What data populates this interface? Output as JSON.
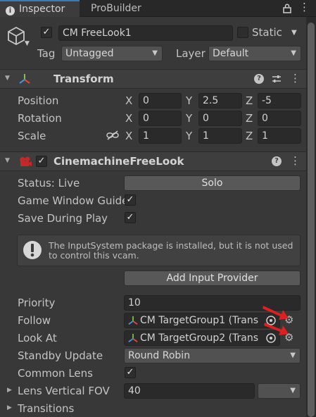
{
  "tabs": {
    "inspector": "Inspector",
    "probuilder": "ProBuilder"
  },
  "object": {
    "name": "CM FreeLook1",
    "static_label": "Static",
    "tag_label": "Tag",
    "tag_value": "Untagged",
    "layer_label": "Layer",
    "layer_value": "Default",
    "active": true,
    "static": false
  },
  "transform": {
    "title": "Transform",
    "position_label": "Position",
    "rotation_label": "Rotation",
    "scale_label": "Scale",
    "position": {
      "x": "0",
      "y": "2.5",
      "z": "-5"
    },
    "rotation": {
      "x": "0",
      "y": "0",
      "z": "0"
    },
    "scale": {
      "x": "1",
      "y": "1",
      "z": "1"
    },
    "axis_x": "X",
    "axis_y": "Y",
    "axis_z": "Z"
  },
  "freelook": {
    "title": "CinemachineFreeLook",
    "status_label": "Status: Live",
    "solo_label": "Solo",
    "game_window_guide_label": "Game Window Guide",
    "save_during_play_label": "Save During Play",
    "help_text": "The InputSystem package is installed, but it is not used to control this vcam.",
    "add_input_provider_label": "Add Input Provider",
    "priority_label": "Priority",
    "priority_value": "10",
    "follow_label": "Follow",
    "follow_value": "CM TargetGroup1 (Trans",
    "look_at_label": "Look At",
    "look_at_value": "CM TargetGroup2 (Trans",
    "standby_update_label": "Standby Update",
    "standby_update_value": "Round Robin",
    "common_lens_label": "Common Lens",
    "lens_fov_label": "Lens Vertical FOV",
    "lens_fov_value": "40",
    "transitions_label": "Transitions",
    "game_window_guide": true,
    "save_during_play": true,
    "common_lens": true
  },
  "colors": {
    "accent": "#3a79bb",
    "annotation_arrow": "#e02020"
  }
}
